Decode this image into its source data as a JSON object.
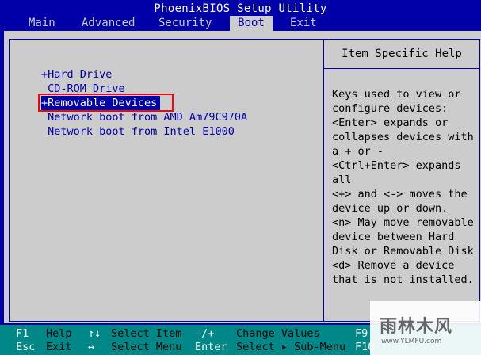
{
  "window": {
    "title": "PhoenixBIOS Setup Utility"
  },
  "menu": {
    "items": [
      {
        "label": "Main"
      },
      {
        "label": "Advanced"
      },
      {
        "label": "Security"
      },
      {
        "label": "Boot",
        "active": true
      },
      {
        "label": "Exit"
      }
    ]
  },
  "boot_order": {
    "items": [
      {
        "label": "+Hard Drive"
      },
      {
        "label": " CD-ROM Drive"
      },
      {
        "label": "+Removable Devices",
        "selected": true
      },
      {
        "label": " Network boot from AMD Am79C970A"
      },
      {
        "label": " Network boot from Intel E1000"
      }
    ]
  },
  "help": {
    "title": "Item Specific Help",
    "lines": [
      "Keys used to view or",
      "configure devices:",
      "<Enter> expands or",
      "collapses devices with",
      "a + or -",
      "<Ctrl+Enter> expands",
      "all",
      "<+> and <-> moves the",
      "device up or down.",
      "<n> May move removable",
      "device between Hard",
      "Disk or Removable Disk",
      "<d> Remove a device",
      "that is not installed."
    ]
  },
  "footer": {
    "row1": [
      {
        "key": "F1",
        "desc": "Help"
      },
      {
        "key": "↑↓",
        "desc": "Select Item"
      },
      {
        "key": "-/+",
        "desc": "Change Values"
      },
      {
        "key": "F9",
        "desc": ""
      }
    ],
    "row2": [
      {
        "key": "Esc",
        "desc": "Exit"
      },
      {
        "key": "↔",
        "desc": "Select Menu"
      },
      {
        "key": "Enter",
        "desc": "Select ▸ Sub-Menu"
      },
      {
        "key": "F10",
        "desc": ""
      }
    ]
  },
  "watermark": {
    "main": "雨林木风",
    "url": "www.YLMFU.com"
  },
  "colors": {
    "bios_blue": "#0000a8",
    "panel_gray": "#cccccc",
    "footer_teal": "#008888",
    "highlight_red": "#ff0000"
  }
}
